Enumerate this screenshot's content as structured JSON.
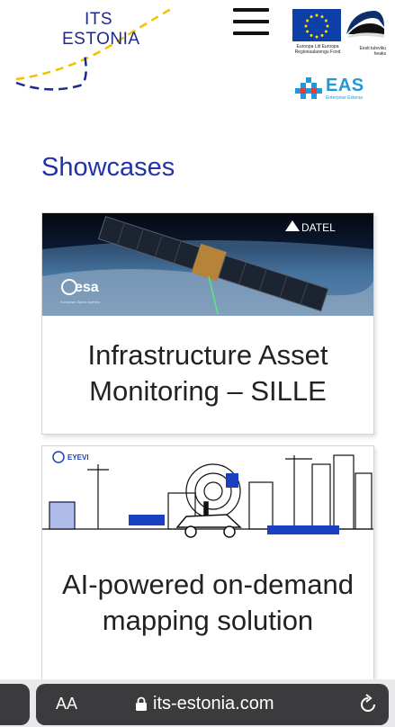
{
  "header": {
    "logo_line1": "ITS",
    "logo_line2": "ESTONIA",
    "eu_caption": "Euroopa Liit Euroopa Regionaalarengu Fond",
    "ee_caption": "Eesti tuleviku heaks",
    "eas_word": "EAS",
    "eas_sub": "Enterprise Estonia"
  },
  "section_title": "Showcases",
  "cards": [
    {
      "title": "Infrastructure Asset Monitoring – SILLE",
      "image_brand_left": "esa",
      "image_brand_left_sub": "European Space Agency",
      "image_brand_right": "DATEL"
    },
    {
      "title": "AI-powered on-demand mapping solution",
      "image_brand": "EYEVI"
    }
  ],
  "browser": {
    "text_size_label": "AA",
    "url": "its-estonia.com"
  },
  "colors": {
    "brand_blue": "#2233a8",
    "logo_yellow": "#f2c200",
    "eas_blue": "#1f9ad6"
  }
}
